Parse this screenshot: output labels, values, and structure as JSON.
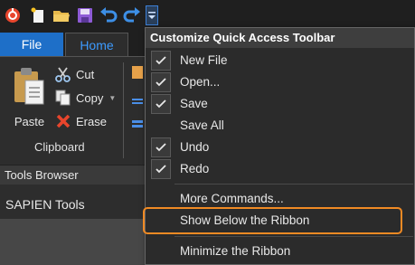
{
  "quick_access": {
    "icons": [
      "app-logo-icon",
      "new-file-icon",
      "open-folder-icon",
      "save-icon",
      "undo-icon",
      "redo-icon"
    ],
    "dropdown_icon": "chevron-down-icon"
  },
  "tabs": [
    {
      "label": "File"
    },
    {
      "label": "Home"
    }
  ],
  "ribbon": {
    "paste_label": "Paste",
    "cut_label": "Cut",
    "copy_label": "Copy",
    "erase_label": "Erase",
    "group_label": "Clipboard"
  },
  "tools_browser": {
    "title": "Tools Browser",
    "item": "SAPIEN Tools"
  },
  "menu": {
    "title": "Customize Quick Access Toolbar",
    "items": [
      {
        "label": "New File",
        "checked": true
      },
      {
        "label": "Open...",
        "checked": true
      },
      {
        "label": "Save",
        "checked": true
      },
      {
        "label": "Save All",
        "checked": false
      },
      {
        "label": "Undo",
        "checked": true
      },
      {
        "label": "Redo",
        "checked": true
      },
      {
        "label": "More Commands..."
      },
      {
        "label": "Show Below the Ribbon"
      },
      {
        "label": "Minimize the Ribbon"
      }
    ]
  },
  "colors": {
    "accent": "#1e6fc8",
    "highlight": "#f08a24"
  }
}
